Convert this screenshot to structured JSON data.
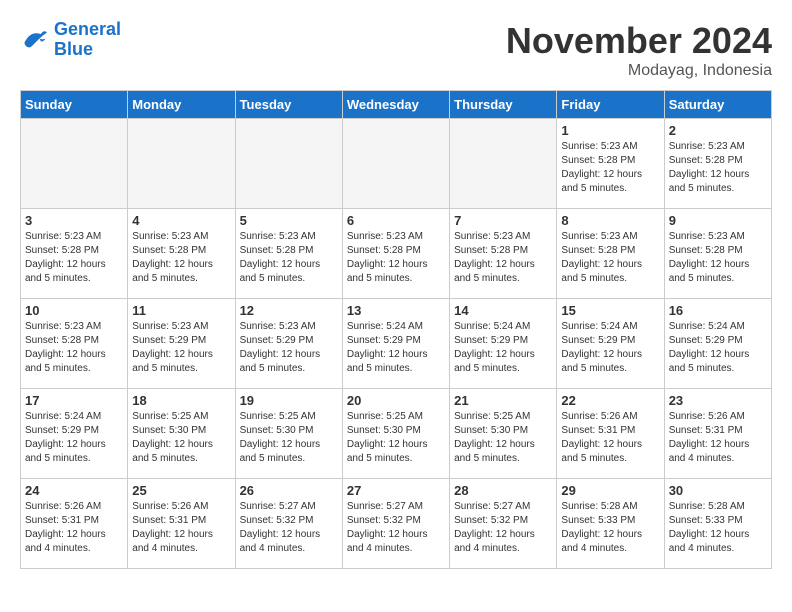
{
  "header": {
    "logo_line1": "General",
    "logo_line2": "Blue",
    "month": "November 2024",
    "location": "Modayag, Indonesia"
  },
  "weekdays": [
    "Sunday",
    "Monday",
    "Tuesday",
    "Wednesday",
    "Thursday",
    "Friday",
    "Saturday"
  ],
  "weeks": [
    [
      {
        "day": "",
        "info": "",
        "empty": true
      },
      {
        "day": "",
        "info": "",
        "empty": true
      },
      {
        "day": "",
        "info": "",
        "empty": true
      },
      {
        "day": "",
        "info": "",
        "empty": true
      },
      {
        "day": "",
        "info": "",
        "empty": true
      },
      {
        "day": "1",
        "info": "Sunrise: 5:23 AM\nSunset: 5:28 PM\nDaylight: 12 hours\nand 5 minutes.",
        "empty": false
      },
      {
        "day": "2",
        "info": "Sunrise: 5:23 AM\nSunset: 5:28 PM\nDaylight: 12 hours\nand 5 minutes.",
        "empty": false
      }
    ],
    [
      {
        "day": "3",
        "info": "Sunrise: 5:23 AM\nSunset: 5:28 PM\nDaylight: 12 hours\nand 5 minutes.",
        "empty": false
      },
      {
        "day": "4",
        "info": "Sunrise: 5:23 AM\nSunset: 5:28 PM\nDaylight: 12 hours\nand 5 minutes.",
        "empty": false
      },
      {
        "day": "5",
        "info": "Sunrise: 5:23 AM\nSunset: 5:28 PM\nDaylight: 12 hours\nand 5 minutes.",
        "empty": false
      },
      {
        "day": "6",
        "info": "Sunrise: 5:23 AM\nSunset: 5:28 PM\nDaylight: 12 hours\nand 5 minutes.",
        "empty": false
      },
      {
        "day": "7",
        "info": "Sunrise: 5:23 AM\nSunset: 5:28 PM\nDaylight: 12 hours\nand 5 minutes.",
        "empty": false
      },
      {
        "day": "8",
        "info": "Sunrise: 5:23 AM\nSunset: 5:28 PM\nDaylight: 12 hours\nand 5 minutes.",
        "empty": false
      },
      {
        "day": "9",
        "info": "Sunrise: 5:23 AM\nSunset: 5:28 PM\nDaylight: 12 hours\nand 5 minutes.",
        "empty": false
      }
    ],
    [
      {
        "day": "10",
        "info": "Sunrise: 5:23 AM\nSunset: 5:28 PM\nDaylight: 12 hours\nand 5 minutes.",
        "empty": false
      },
      {
        "day": "11",
        "info": "Sunrise: 5:23 AM\nSunset: 5:29 PM\nDaylight: 12 hours\nand 5 minutes.",
        "empty": false
      },
      {
        "day": "12",
        "info": "Sunrise: 5:23 AM\nSunset: 5:29 PM\nDaylight: 12 hours\nand 5 minutes.",
        "empty": false
      },
      {
        "day": "13",
        "info": "Sunrise: 5:24 AM\nSunset: 5:29 PM\nDaylight: 12 hours\nand 5 minutes.",
        "empty": false
      },
      {
        "day": "14",
        "info": "Sunrise: 5:24 AM\nSunset: 5:29 PM\nDaylight: 12 hours\nand 5 minutes.",
        "empty": false
      },
      {
        "day": "15",
        "info": "Sunrise: 5:24 AM\nSunset: 5:29 PM\nDaylight: 12 hours\nand 5 minutes.",
        "empty": false
      },
      {
        "day": "16",
        "info": "Sunrise: 5:24 AM\nSunset: 5:29 PM\nDaylight: 12 hours\nand 5 minutes.",
        "empty": false
      }
    ],
    [
      {
        "day": "17",
        "info": "Sunrise: 5:24 AM\nSunset: 5:29 PM\nDaylight: 12 hours\nand 5 minutes.",
        "empty": false
      },
      {
        "day": "18",
        "info": "Sunrise: 5:25 AM\nSunset: 5:30 PM\nDaylight: 12 hours\nand 5 minutes.",
        "empty": false
      },
      {
        "day": "19",
        "info": "Sunrise: 5:25 AM\nSunset: 5:30 PM\nDaylight: 12 hours\nand 5 minutes.",
        "empty": false
      },
      {
        "day": "20",
        "info": "Sunrise: 5:25 AM\nSunset: 5:30 PM\nDaylight: 12 hours\nand 5 minutes.",
        "empty": false
      },
      {
        "day": "21",
        "info": "Sunrise: 5:25 AM\nSunset: 5:30 PM\nDaylight: 12 hours\nand 5 minutes.",
        "empty": false
      },
      {
        "day": "22",
        "info": "Sunrise: 5:26 AM\nSunset: 5:31 PM\nDaylight: 12 hours\nand 5 minutes.",
        "empty": false
      },
      {
        "day": "23",
        "info": "Sunrise: 5:26 AM\nSunset: 5:31 PM\nDaylight: 12 hours\nand 4 minutes.",
        "empty": false
      }
    ],
    [
      {
        "day": "24",
        "info": "Sunrise: 5:26 AM\nSunset: 5:31 PM\nDaylight: 12 hours\nand 4 minutes.",
        "empty": false
      },
      {
        "day": "25",
        "info": "Sunrise: 5:26 AM\nSunset: 5:31 PM\nDaylight: 12 hours\nand 4 minutes.",
        "empty": false
      },
      {
        "day": "26",
        "info": "Sunrise: 5:27 AM\nSunset: 5:32 PM\nDaylight: 12 hours\nand 4 minutes.",
        "empty": false
      },
      {
        "day": "27",
        "info": "Sunrise: 5:27 AM\nSunset: 5:32 PM\nDaylight: 12 hours\nand 4 minutes.",
        "empty": false
      },
      {
        "day": "28",
        "info": "Sunrise: 5:27 AM\nSunset: 5:32 PM\nDaylight: 12 hours\nand 4 minutes.",
        "empty": false
      },
      {
        "day": "29",
        "info": "Sunrise: 5:28 AM\nSunset: 5:33 PM\nDaylight: 12 hours\nand 4 minutes.",
        "empty": false
      },
      {
        "day": "30",
        "info": "Sunrise: 5:28 AM\nSunset: 5:33 PM\nDaylight: 12 hours\nand 4 minutes.",
        "empty": false
      }
    ]
  ]
}
